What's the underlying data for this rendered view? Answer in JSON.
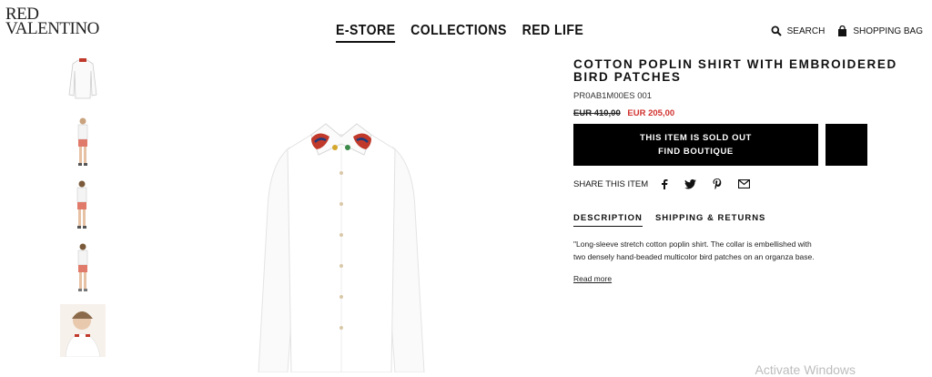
{
  "brand": {
    "line1": "RED",
    "line2": "VALENTINO"
  },
  "nav": {
    "items": [
      "E-STORE",
      "COLLECTIONS",
      "RED LIFE"
    ]
  },
  "header": {
    "search_label": "SEARCH",
    "bag_label": "SHOPPING BAG"
  },
  "product": {
    "title": "COTTON POPLIN SHIRT WITH EMBROIDERED BIRD PATCHES",
    "sku": "PR0AB1M00ES 001",
    "old_price": "EUR 410,00",
    "new_price": "EUR 205,00",
    "sold_out_line1": "THIS ITEM IS SOLD OUT",
    "sold_out_line2": "FIND BOUTIQUE",
    "share_label": "SHARE THIS ITEM",
    "tabs": [
      "DESCRIPTION",
      "SHIPPING & RETURNS"
    ],
    "description": "\"Long-sleeve stretch cotton poplin shirt. The collar is embellished with two densely hand-beaded multicolor bird patches on an organza base.",
    "read_more": "Read more"
  },
  "watermark": "Activate Windows",
  "colors": {
    "sale": "#d0312d",
    "button": "#000000"
  },
  "icons": [
    "search-icon",
    "bag-icon",
    "facebook-icon",
    "twitter-icon",
    "pinterest-icon",
    "mail-icon"
  ]
}
